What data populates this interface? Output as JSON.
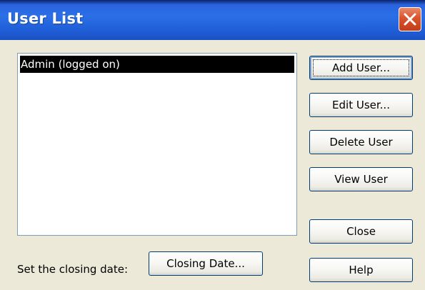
{
  "window": {
    "title": "User List"
  },
  "users": [
    "Admin (logged on)"
  ],
  "buttons": {
    "add_user": "Add User...",
    "edit_user": "Edit User...",
    "delete_user": "Delete User",
    "view_user": "View User",
    "close": "Close",
    "help": "Help",
    "closing_date": "Closing Date..."
  },
  "closing": {
    "label": "Set the closing date:"
  },
  "icons": {
    "close": "close-icon"
  },
  "colors": {
    "title_bar": "#2b6fe6",
    "close_button": "#d9532c",
    "selection": "#000000",
    "dialog_background": "#ece9d8"
  }
}
